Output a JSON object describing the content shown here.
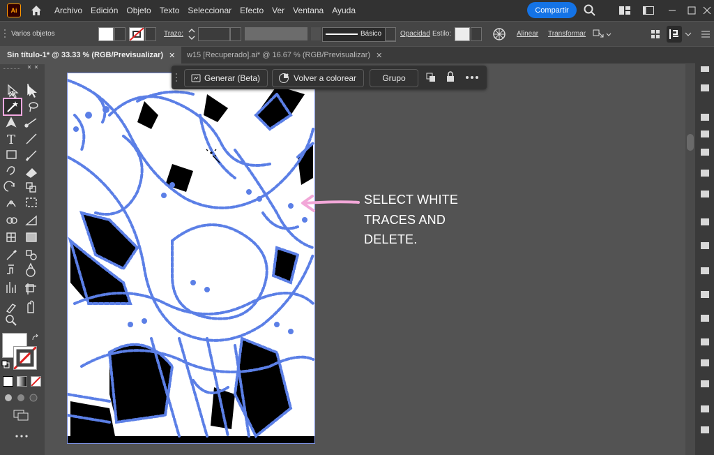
{
  "app": {
    "logo": "Ai"
  },
  "menu": [
    "Archivo",
    "Edición",
    "Objeto",
    "Texto",
    "Seleccionar",
    "Efecto",
    "Ver",
    "Ventana",
    "Ayuda"
  ],
  "share_label": "Compartir",
  "control_bar": {
    "selection_label": "Varios objetos",
    "stroke_label": "Trazo:",
    "brush_label": "Básico",
    "opacity_label": "Opacidad",
    "style_label": "Estilo:",
    "align_label": "Alinear",
    "transform_label": "Transformar"
  },
  "tabs": [
    {
      "label": "Sin título-1* @ 33.33 % (RGB/Previsualizar)",
      "active": true
    },
    {
      "label": "w15 [Recuperado].ai* @ 16.67 % (RGB/Previsualizar)",
      "active": false
    }
  ],
  "context_bar": {
    "generate_label": "Generar (Beta)",
    "recolor_label": "Volver a colorear",
    "group_label": "Grupo"
  },
  "annotation": {
    "lines": [
      "SELECT WHITE",
      "TRACES AND",
      "DELETE."
    ],
    "arrow_color": "#f2a7d8"
  },
  "colors": {
    "accent": "#1473e6",
    "trace_blue": "#5b7fe6",
    "highlight": "#f4a8e0"
  },
  "tools": [
    "selection-icon",
    "direct-selection-icon",
    "magic-wand-icon",
    "lasso-icon",
    "pen-icon",
    "curvature-icon",
    "type-icon",
    "line-icon",
    "rectangle-icon",
    "paintbrush-icon",
    "shaper-icon",
    "eraser-icon",
    "rotate-icon",
    "scale-icon",
    "puppet-warp-icon",
    "free-transform-icon",
    "shape-builder-icon",
    "perspective-icon",
    "mesh-icon",
    "gradient-icon",
    "eyedropper-icon",
    "blend-icon",
    "symbol-sprayer-icon",
    "graph-icon",
    "artboard-icon",
    "slice-icon",
    "hand-icon",
    "zoom-icon"
  ]
}
